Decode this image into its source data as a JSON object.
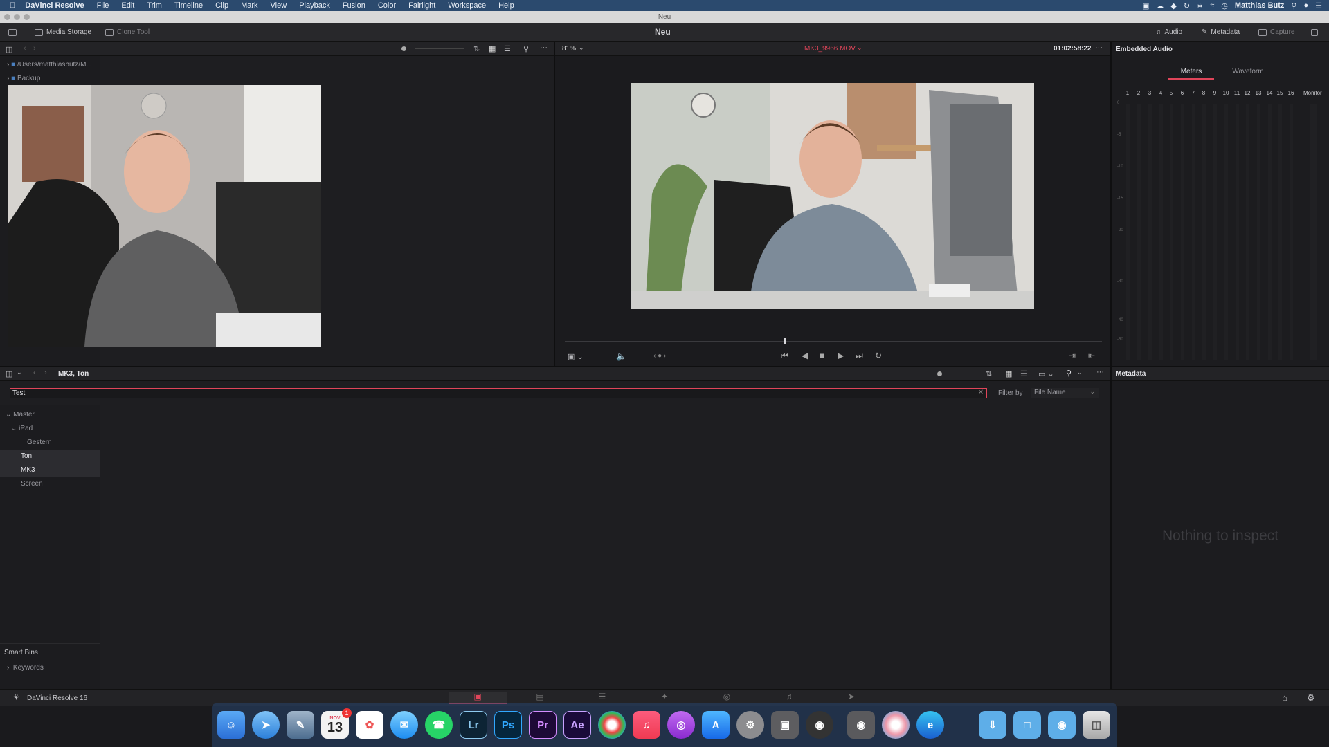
{
  "menubar": {
    "app_name": "DaVinci Resolve",
    "items": [
      "File",
      "Edit",
      "Trim",
      "Timeline",
      "Clip",
      "Mark",
      "View",
      "Playback",
      "Fusion",
      "Color",
      "Fairlight",
      "Workspace",
      "Help"
    ],
    "user": "Matthias Butz"
  },
  "window": {
    "title": "Neu"
  },
  "toolbar": {
    "media_storage": "Media Storage",
    "clone_tool": "Clone Tool",
    "project_title": "Neu",
    "audio": "Audio",
    "metadata": "Metadata",
    "capture": "Capture"
  },
  "storage": {
    "items": [
      "/Users/matthiasbutz/M...",
      "Backup"
    ]
  },
  "viewer": {
    "zoom": "81%",
    "clip_name": "MK3_9966.MOV",
    "timecode": "01:02:58:22"
  },
  "audio_panel": {
    "title": "Embedded Audio",
    "tabs": [
      "Meters",
      "Waveform"
    ],
    "channels": [
      "1",
      "2",
      "3",
      "4",
      "5",
      "6",
      "7",
      "8",
      "9",
      "10",
      "11",
      "12",
      "13",
      "14",
      "15",
      "16"
    ],
    "monitor": "Monitor",
    "scale": [
      "0",
      "-5",
      "-10",
      "-15",
      "-20",
      "-30",
      "-40",
      "-50"
    ]
  },
  "media_pool": {
    "breadcrumb": "MK3, Ton",
    "search_value": "Test",
    "filter_label": "Filter by",
    "filter_value": "File Name",
    "bins": {
      "master": "Master",
      "ipad": "iPad",
      "gestern": "Gestern",
      "ton": "Ton",
      "mk3": "MK3",
      "screen": "Screen"
    },
    "smart_bins": "Smart Bins",
    "keywords": "Keywords"
  },
  "metadata_panel": {
    "title": "Metadata",
    "empty": "Nothing to inspect"
  },
  "pagebar": {
    "app_version": "DaVinci Resolve 16"
  },
  "dock": {
    "icons": [
      "finder-icon",
      "safari-icon",
      "preview-icon",
      "calendar-icon",
      "photos-icon",
      "messages-icon",
      "whatsapp-icon",
      "lightroom-icon",
      "photoshop-icon",
      "premiere-icon",
      "aftereffects-icon",
      "resolve-icon",
      "music-icon",
      "podcasts-icon",
      "appstore-icon",
      "settings-icon",
      "screenshot-icon",
      "cinema-icon",
      "camera-icon",
      "pixelmator-icon",
      "edge-icon",
      "downloads-icon",
      "folder-icon",
      "screenshots-folder-icon",
      "trash-icon"
    ],
    "labels": {
      "lightroom": "Lr",
      "photoshop": "Ps",
      "premiere": "Pr",
      "aftereffects": "Ae",
      "calendar_day": "13",
      "calendar_month": "NOV",
      "calendar_badge": "1"
    }
  },
  "colors": {
    "accent": "#e0455a",
    "bg": "#1a1a1d",
    "panel": "#1e1e21"
  }
}
